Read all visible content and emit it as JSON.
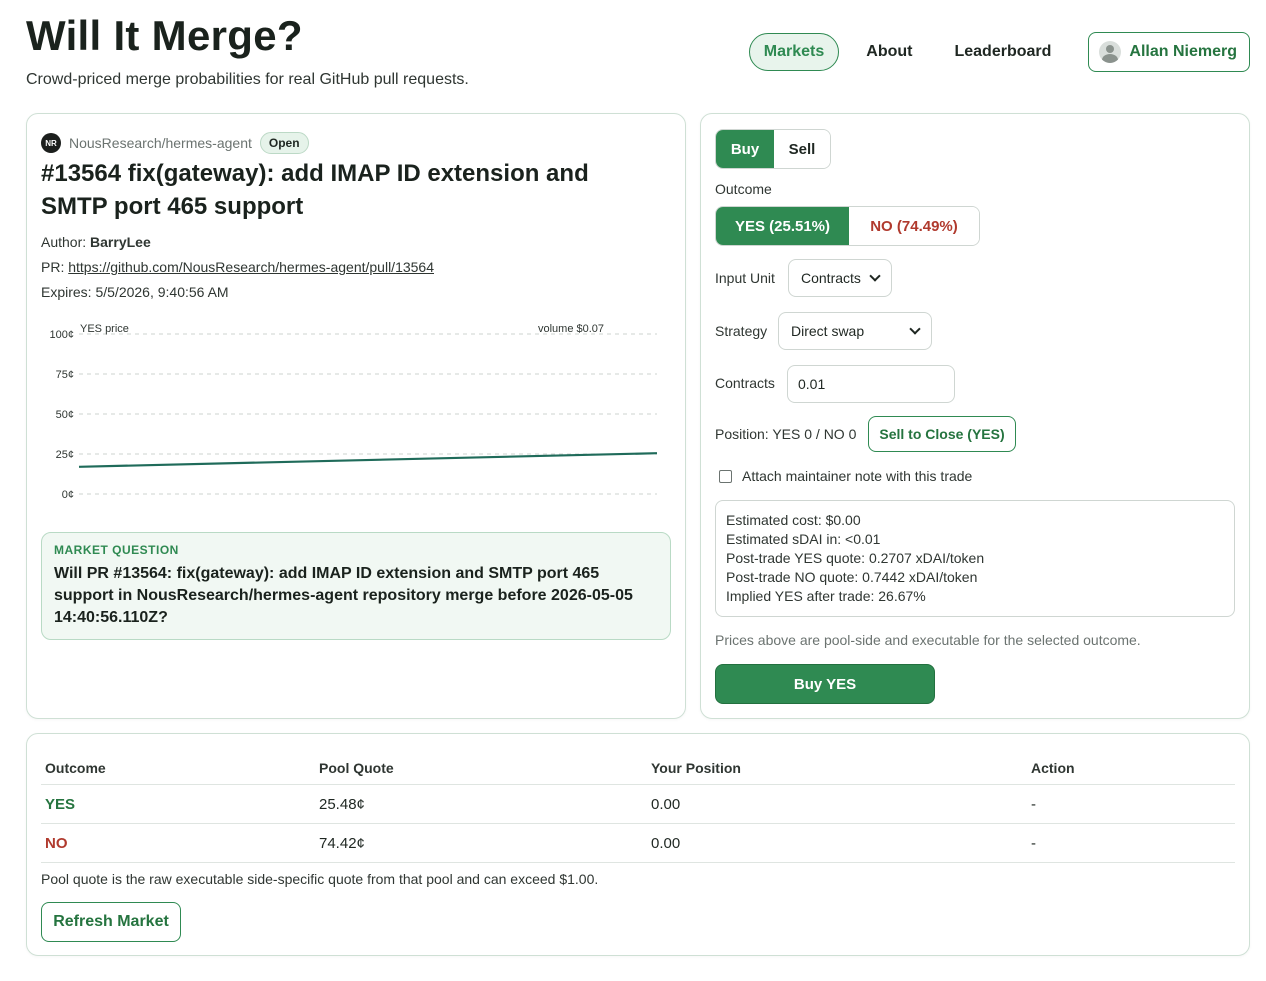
{
  "site": {
    "title": "Will It Merge?",
    "subtitle": "Crowd-priced merge probabilities for real GitHub pull requests."
  },
  "nav": {
    "items": [
      {
        "label": "Markets",
        "active": true
      },
      {
        "label": "About",
        "active": false
      },
      {
        "label": "Leaderboard",
        "active": false
      }
    ],
    "user": "Allan Niemerg"
  },
  "pr": {
    "repo": "NousResearch/hermes-agent",
    "repo_icon_text": "NR",
    "status": "Open",
    "title": "#13564 fix(gateway): add IMAP ID extension and SMTP port 465 support",
    "author_label": "Author:",
    "author": "BarryLee",
    "pr_label": "PR:",
    "pr_url": "https://github.com/NousResearch/hermes-agent/pull/13564",
    "expires": "Expires: 5/5/2026, 9:40:56 AM"
  },
  "chart_data": {
    "type": "line",
    "series": [
      {
        "name": "YES price",
        "x": [
          0,
          1
        ],
        "values": [
          17,
          25.5
        ]
      }
    ],
    "ylim": [
      0,
      100
    ],
    "ytick_labels": [
      "100¢",
      "75¢",
      "50¢",
      "25¢",
      "0¢"
    ],
    "legend_label": "YES price",
    "volume_label": "volume $0.07",
    "grid": true,
    "color": "#1f6b5a"
  },
  "question": {
    "label": "MARKET QUESTION",
    "text": "Will PR #13564: fix(gateway): add IMAP ID extension and SMTP port 465 support in NousResearch/hermes-agent repository merge before 2026-05-05 14:40:56.110Z?"
  },
  "trade": {
    "buy_label": "Buy",
    "sell_label": "Sell",
    "outcome_label": "Outcome",
    "yes_option": "YES (25.51%)",
    "no_option": "NO (74.49%)",
    "input_unit_label": "Input Unit",
    "input_unit_value": "Contracts",
    "strategy_label": "Strategy",
    "strategy_value": "Direct swap",
    "contracts_label": "Contracts",
    "contracts_value": "0.01",
    "position_text": "Position: YES 0 / NO 0",
    "sell_to_close_label": "Sell to Close (YES)",
    "attach_note_label": "Attach maintainer note with this trade",
    "estimates": [
      "Estimated cost: $0.00",
      "Estimated sDAI in: <0.01",
      "Post-trade YES quote: 0.2707 xDAI/token",
      "Post-trade NO quote: 0.7442 xDAI/token",
      "Implied YES after trade: 26.67%"
    ],
    "prices_note": "Prices above are pool-side and executable for the selected outcome.",
    "submit_label": "Buy YES"
  },
  "pool_table": {
    "headers": [
      "Outcome",
      "Pool Quote",
      "Your Position",
      "Action"
    ],
    "rows": [
      {
        "outcome": "YES",
        "quote": "25.48¢",
        "position": "0.00",
        "action": "-"
      },
      {
        "outcome": "NO",
        "quote": "74.42¢",
        "position": "0.00",
        "action": "-"
      }
    ],
    "note": "Pool quote is the raw executable side-specific quote from that pool and can exceed $1.00.",
    "refresh_label": "Refresh Market"
  },
  "colors": {
    "accent": "#2f8a52",
    "no": "#b03a2e",
    "line": "#1f6b5a"
  }
}
